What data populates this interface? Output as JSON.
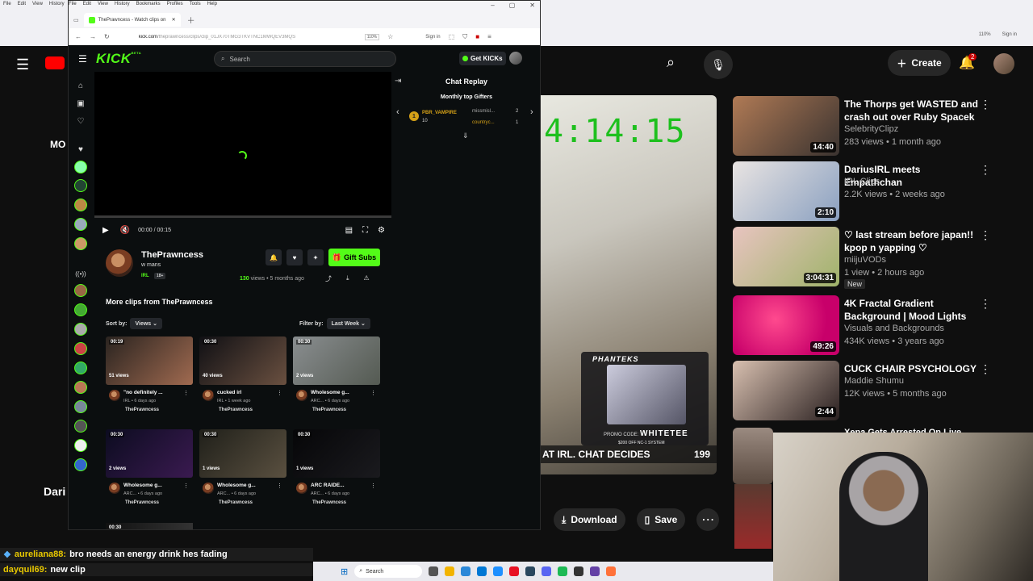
{
  "youtube": {
    "header": {
      "create_label": "Create",
      "notif_count": "2"
    },
    "partial_left": {
      "label_mo": "MO",
      "title_partial": "Dari"
    },
    "video": {
      "timer": "4:14:15",
      "sponsor_logo": "PHANTEKS",
      "promo_label": "PROMO CODE:",
      "promo_code": "WHITETEE",
      "promo_sub": "$200 OFF NC-1 SYSTEM",
      "banner_text": "AT IRL. CHAT DECIDES",
      "banner_count": "199"
    },
    "actions": {
      "download": "Download",
      "save": "Save"
    },
    "recommendations": [
      {
        "title": "The Thorps get WASTED and crash out over Ruby Spacek an...",
        "channel": "SelebrityClipz",
        "meta": "283 views • 1 month ago",
        "duration": "14:40",
        "color1": "#b07a55",
        "color2": "#3a3330",
        "new": ""
      },
      {
        "title": "DariusIRL meets Empathchan",
        "channel": "IRL Clips",
        "meta": "2.2K views • 2 weeks ago",
        "duration": "2:10",
        "color1": "#e9e4e2",
        "color2": "#8aa0c0",
        "new": ""
      },
      {
        "title": "♡ last stream before japan!! kpop n yapping ♡",
        "channel": "miijuVODs",
        "meta": "1 view • 2 hours ago",
        "duration": "3:04:31",
        "color1": "#e8c4c0",
        "color2": "#9fb36a",
        "new": "New"
      },
      {
        "title": "4K Fractal Gradient Background | Mood Lights",
        "channel": "Visuals and Backgrounds",
        "meta": "434K views • 3 years ago",
        "duration": "49:26",
        "color1": "#ff1a6e",
        "color2": "#c8006a",
        "new": ""
      },
      {
        "title": "CUCK CHAIR PSYCHOLOGY",
        "channel": "Maddie Shumu",
        "meta": "12K views • 5 months ago",
        "duration": "2:44",
        "color1": "#d8c0b0",
        "color2": "#2a2020",
        "new": ""
      }
    ],
    "partial_rec_title": "Xena Gets Arrested On Live",
    "chat": [
      {
        "user": "aureliana88:",
        "text": "bro needs an energy drink hes fading"
      },
      {
        "user": "dayquil69:",
        "text": "new clip"
      }
    ],
    "taskbar": {
      "search": "Search"
    }
  },
  "kick": {
    "browser": {
      "menu": [
        "File",
        "Edit",
        "View",
        "History",
        "Bookmarks",
        "Profiles",
        "Tools",
        "Help"
      ],
      "tab_title": "ThePrawncess - Watch clips on",
      "url_host": "kick.com",
      "url_path": "/theprawncess/clips/clip_01JX70TMG3TKVTNC1MWQEV3MQS",
      "zoom": "110%",
      "sign_in": "Sign in"
    },
    "topbar": {
      "logo": "KICK",
      "logo_sup": "BETA",
      "search_placeholder": "Search",
      "get_kicks": "Get KICKs"
    },
    "player": {
      "time": "00:00 / 00:15"
    },
    "chat": {
      "title": "Chat Replay",
      "gifters_title": "Monthly top Gifters",
      "first": {
        "rank": "1",
        "name": "PBR_VAMPIRE",
        "count": "10"
      },
      "second": {
        "name": "missmisl...",
        "count": "2"
      },
      "third": {
        "name": "countryc...",
        "count": "1"
      }
    },
    "channel": {
      "name": "ThePrawncess",
      "stream_title": "w mans",
      "category": "IRL",
      "age": "18+",
      "views_count": "130",
      "views_rest": " views • 5 months ago",
      "gift_subs": "Gift Subs"
    },
    "clips_section": {
      "title": "More clips from ThePrawncess",
      "sort_label": "Sort by:",
      "sort_value": "Views",
      "filter_label": "Filter by:",
      "filter_value": "Last Week"
    },
    "clips": [
      {
        "duration": "00:19",
        "views": "51 views",
        "title": "\"no definitely ...",
        "meta": "IRL • 6 days ago",
        "channel": "ThePrawncess",
        "c1": "#2a2420",
        "c2": "#a06a50"
      },
      {
        "duration": "00:30",
        "views": "40 views",
        "title": "cucked irl",
        "meta": "IRL • 1 week ago",
        "channel": "ThePrawncess",
        "c1": "#101014",
        "c2": "#6a5040"
      },
      {
        "duration": "00:30",
        "views": "2 views",
        "title": "Wholesome g...",
        "meta": "ARC... • 6 days ago",
        "channel": "ThePrawncess",
        "c1": "#8a8e90",
        "c2": "#545a52"
      },
      {
        "duration": "00:30",
        "views": "2 views",
        "title": "Wholesome g...",
        "meta": "ARC... • 6 days ago",
        "channel": "ThePrawncess",
        "c1": "#0c0c20",
        "c2": "#3a1a50"
      },
      {
        "duration": "00:30",
        "views": "1 views",
        "title": "Wholesome g...",
        "meta": "ARC... • 6 days ago",
        "channel": "ThePrawncess",
        "c1": "#20201a",
        "c2": "#5a5040"
      },
      {
        "duration": "00:30",
        "views": "1 views",
        "title": "ARC RAIDE...",
        "meta": "ARC... • 6 days ago",
        "channel": "ThePrawncess",
        "c1": "#060608",
        "c2": "#1a1a1e"
      }
    ],
    "partial_clip_duration": "00:30"
  },
  "colors": {
    "kick_green": "#53fc18",
    "yt_red": "#ff0000"
  }
}
